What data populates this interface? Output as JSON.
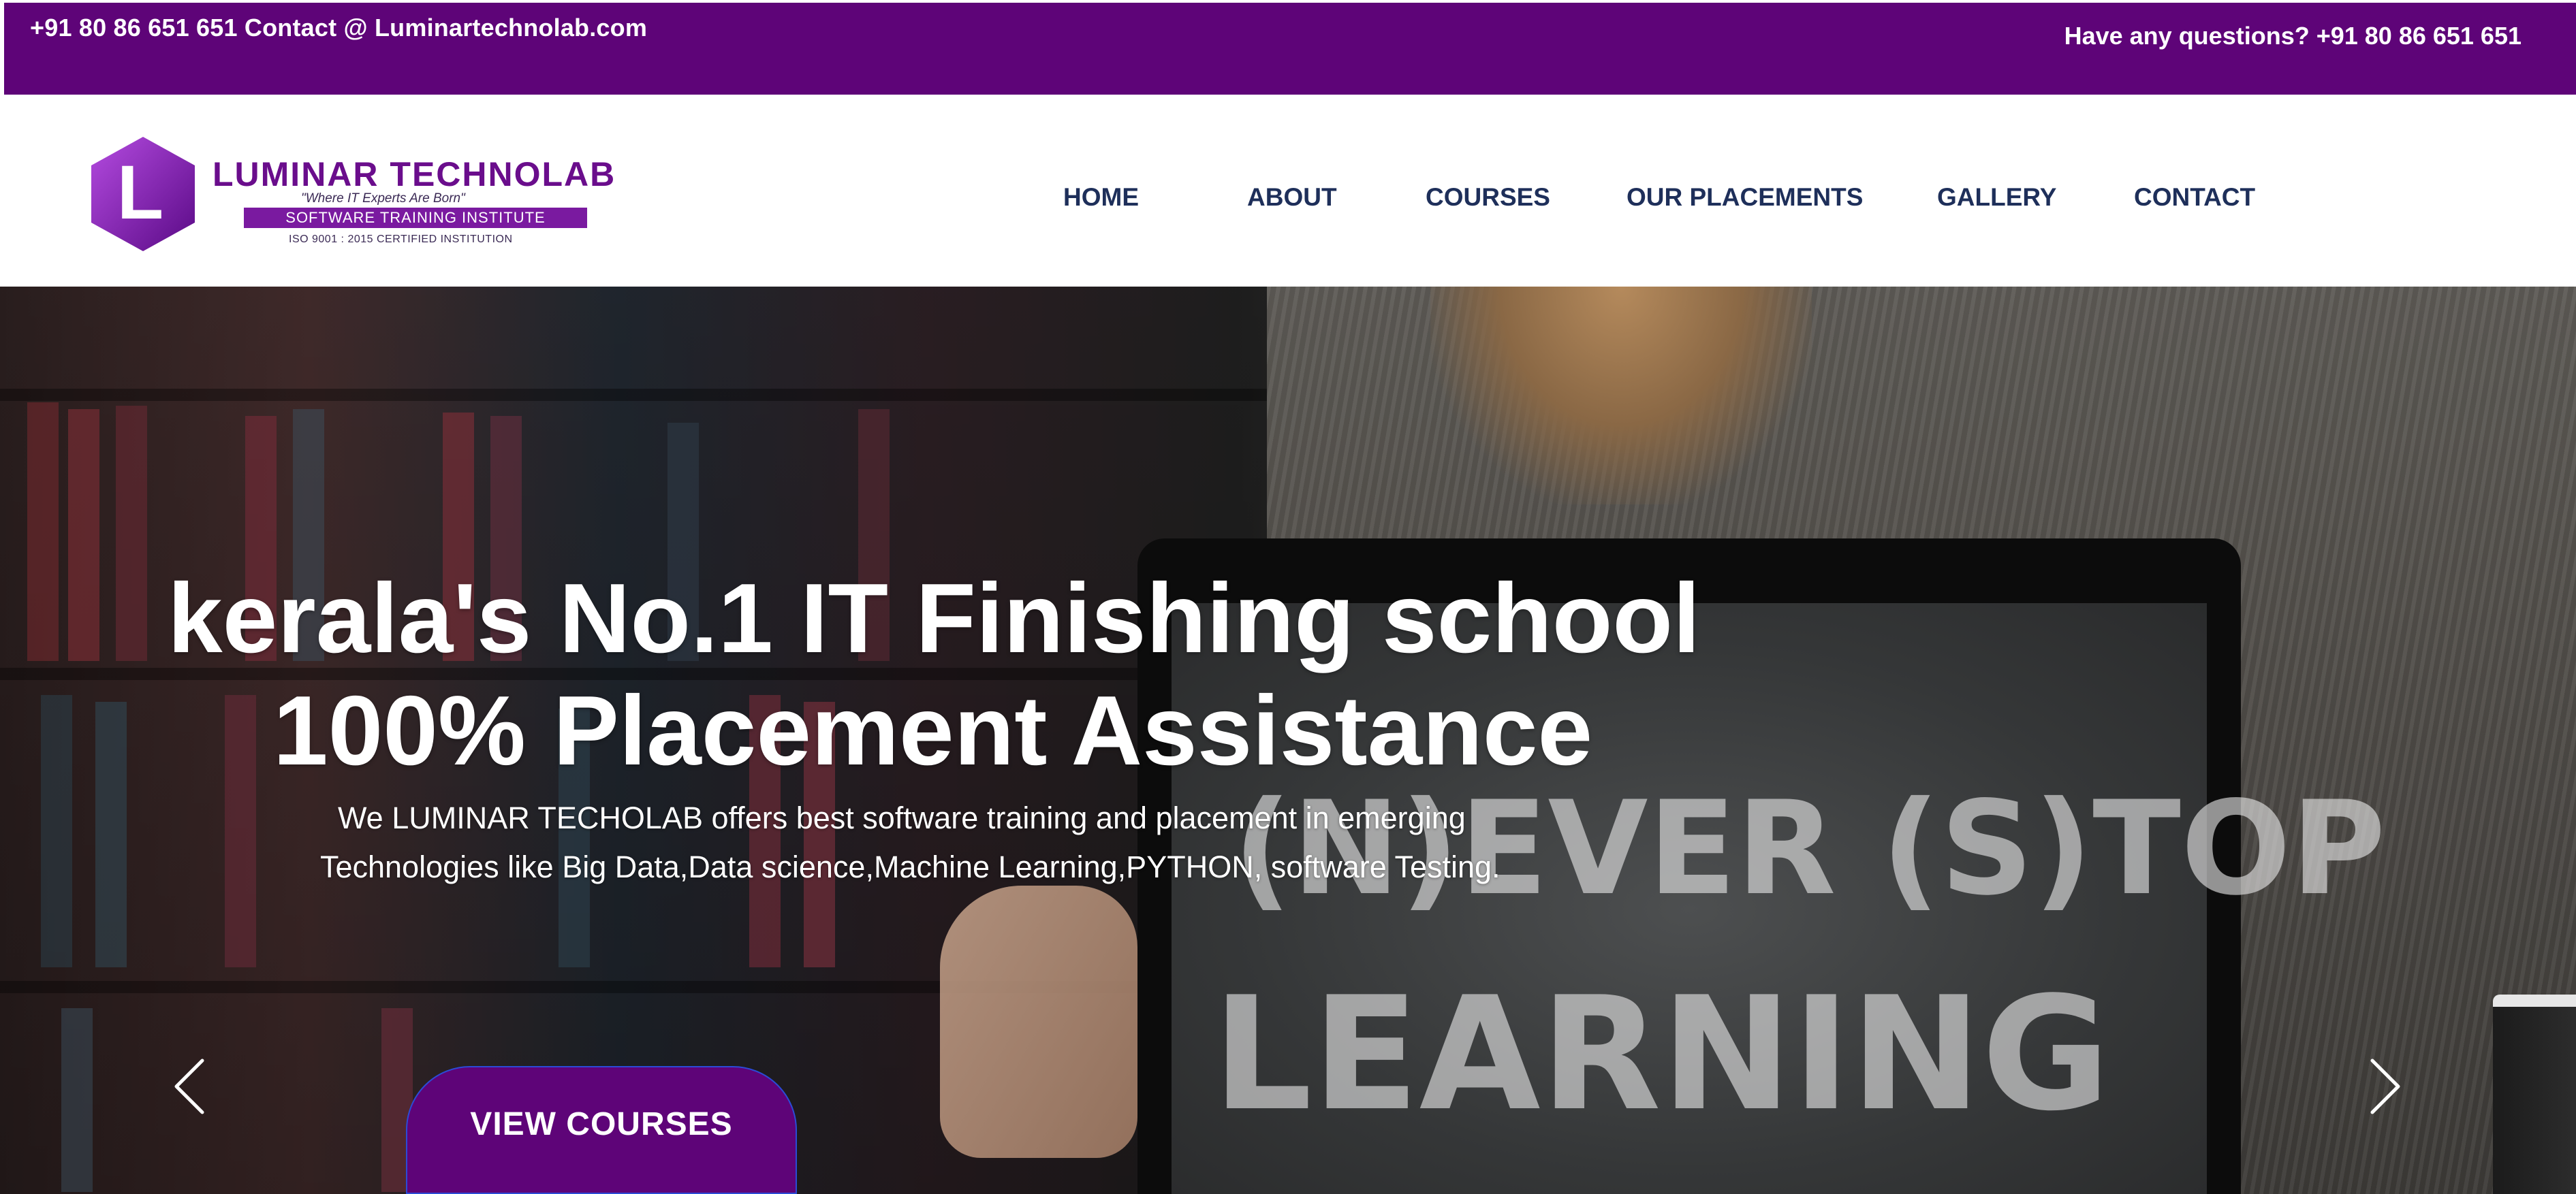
{
  "topbar": {
    "left_text": "+91 80 86 651 651 Contact @ Luminartechnolab.com",
    "right_text": "Have any questions? +91 80 86 651 651"
  },
  "logo": {
    "name": "LUMINAR TECHNOLAB",
    "tagline": "\"Where IT Experts Are Born\"",
    "subtitle": "SOFTWARE TRAINING INSTITUTE",
    "iso": "ISO 9001 : 2015 CERTIFIED INSTITUTION",
    "mark_letter": "L"
  },
  "nav": {
    "items": [
      "HOME",
      "ABOUT",
      "COURSES",
      "OUR PLACEMENTS",
      "GALLERY",
      "CONTACT"
    ]
  },
  "hero": {
    "headline_line1": "kerala's No.1 IT Finishing school",
    "headline_line2": "100% Placement Assistance",
    "desc_line1": "We LUMINAR TECHOLAB offers best software training and placement in emerging",
    "desc_line2": "Technologies like Big Data,Data science,Machine Learning,PYTHON, software Testing.",
    "cta_label": "VIEW COURSES",
    "chalk_line1": "(N)EVER (S)TOP",
    "chalk_line2": "LEARNING",
    "prev_icon": "chevron-left-icon",
    "next_icon": "chevron-right-icon"
  },
  "colors": {
    "brand_purple": "#5e0478",
    "nav_text": "#1e2f5a",
    "logo_purple": "#6a0d8c"
  }
}
